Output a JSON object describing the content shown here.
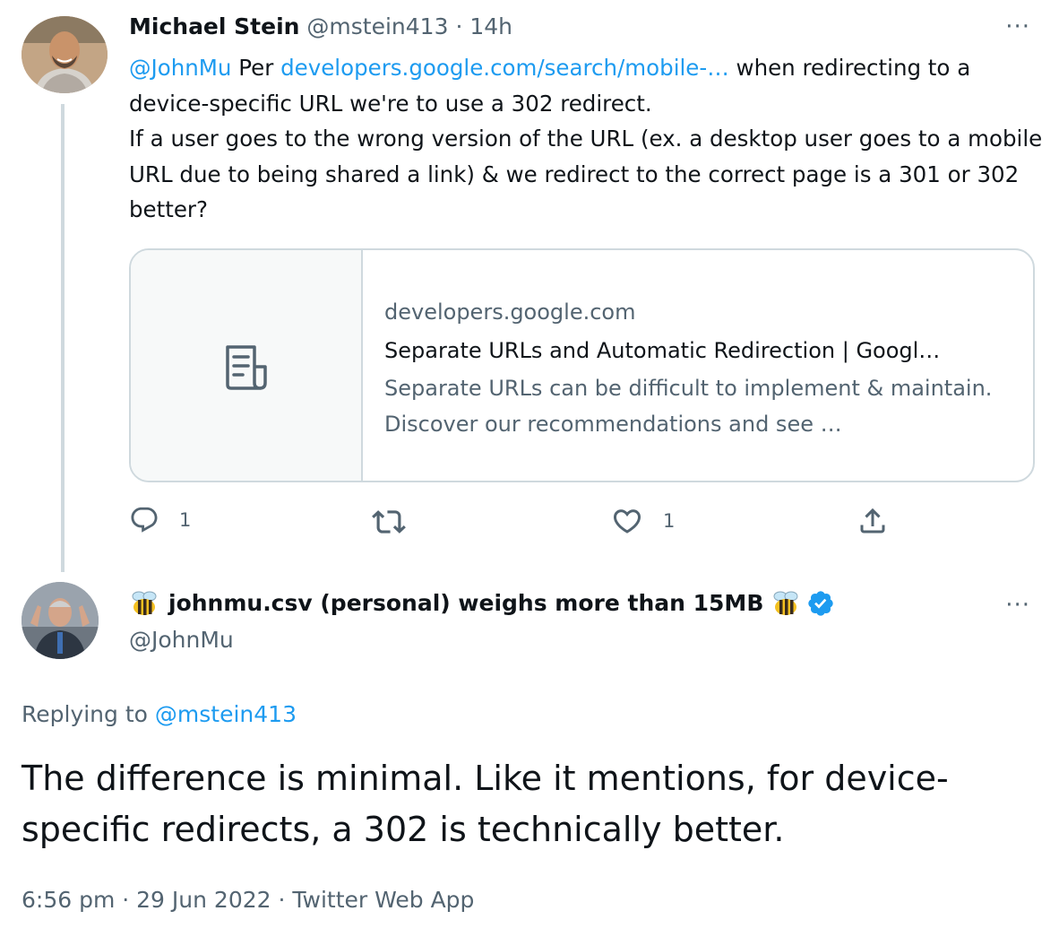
{
  "tweet1": {
    "name": "Michael Stein",
    "handle": "@mstein413",
    "separator": "·",
    "time": "14h",
    "more": "···",
    "mention": "@JohnMu",
    "text_before_link": "Per",
    "link_text": "developers.google.com/search/mobile-…",
    "text_after_link": "when redirecting to a device-specific URL we're to use a 302 redirect.",
    "text_paragraph2": "If a user goes to the wrong version of the URL (ex. a desktop user goes to a mobile URL due to being shared a link) & we redirect to the correct page is a 301 or 302 better?",
    "card": {
      "domain": "developers.google.com",
      "title": "Separate URLs and Automatic Redirection | Googl…",
      "description": "Separate URLs can be difficult to implement & maintain. Discover our recommendations and see …",
      "icon": "document-icon"
    },
    "actions": {
      "reply_count": "1",
      "retweet_count": "",
      "like_count": "1"
    }
  },
  "tweet2": {
    "name": "johnmu.csv (personal) weighs more than 15MB",
    "handle": "@JohnMu",
    "more": "···",
    "verified": true,
    "replying_prefix": "Replying to",
    "replying_handle": "@mstein413",
    "text": "The difference is minimal. Like it mentions, for device-specific redirects, a 302 is technically better.",
    "meta": "6:56 pm · 29 Jun 2022 · Twitter Web App"
  },
  "colors": {
    "text": "#0f1419",
    "secondary": "#536471",
    "link": "#1d9bf0",
    "border": "#cfd9de",
    "verified": "#1d9bf0"
  }
}
